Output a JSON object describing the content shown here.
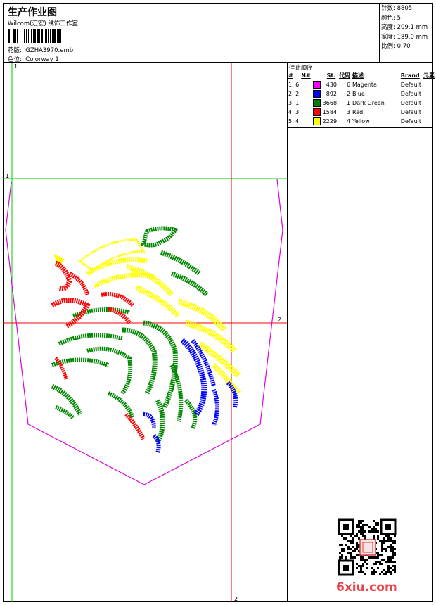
{
  "header": {
    "title": "生产作业图",
    "subtitle": "Wilcom(汇宏) 绣饰工作室",
    "design_label": "花版:",
    "design_file": "GZHA3970.emb",
    "colorway_label": "色位:",
    "colorway": "Colorway 1"
  },
  "stats": [
    {
      "label": "针数:",
      "value": "8805"
    },
    {
      "label": "颜色:",
      "value": "5"
    },
    {
      "label": "高度:",
      "value": "209.1 mm"
    },
    {
      "label": "宽度:",
      "value": "189.0 mm"
    },
    {
      "label": "比例:",
      "value": "0.70"
    }
  ],
  "stop_sequence": {
    "title": "停止顺序:",
    "columns": [
      "#",
      "N#",
      "St.",
      "代码",
      "描述",
      "Brand",
      "元素"
    ],
    "rows": [
      {
        "idx": "1. 6",
        "color": "#ff00ff",
        "st": "430",
        "code": "6",
        "desc": "Magenta",
        "brand": "Default"
      },
      {
        "idx": "2. 2",
        "color": "#0000ff",
        "st": "892",
        "code": "2",
        "desc": "Blue",
        "brand": "Default"
      },
      {
        "idx": "3. 1",
        "color": "#008000",
        "st": "3668",
        "code": "1",
        "desc": "Dark Green",
        "brand": "Default"
      },
      {
        "idx": "4. 3",
        "color": "#ff0000",
        "st": "1584",
        "code": "3",
        "desc": "Red",
        "brand": "Default"
      },
      {
        "idx": "5. 4",
        "color": "#ffff00",
        "st": "2229",
        "code": "4",
        "desc": "Yellow",
        "brand": "Default"
      }
    ]
  },
  "guides": {
    "v_green_label": "1",
    "h_green_label": "1",
    "h_red_label": "2",
    "v_red_label": "2"
  },
  "watermark": "6xiu.com"
}
